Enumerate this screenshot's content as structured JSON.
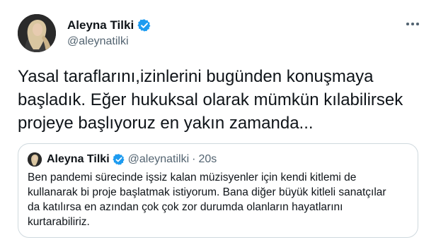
{
  "tweet": {
    "author": {
      "name": "Aleyna Tilki",
      "handle": "@aleynatilki",
      "verified": true
    },
    "text": "Yasal taraflarını,izinlerini bugünden konuşmaya\nbaşladık. Eğer hukuksal olarak mümkün kılabilirsek\nprojeye başlıyoruz en yakın zamanda...",
    "more_icon": "more-horizontal-icon"
  },
  "quote": {
    "author": {
      "name": "Aleyna Tilki",
      "handle": "@aleynatilki",
      "verified": true
    },
    "separator": "·",
    "time": "20s",
    "text": "Ben pandemi sürecinde işsiz kalan müzisyenler için kendi kitlemi de\nkullanarak bi proje başlatmak istiyorum. Bana diğer büyük kitleli sanatçılar\nda katılırsa en azından çok çok zor durumda olanların hayatlarını\nkurtarabiliriz."
  },
  "colors": {
    "verified_badge": "#1d9bf0",
    "secondary_text": "#536471",
    "border": "#cfd9de"
  }
}
